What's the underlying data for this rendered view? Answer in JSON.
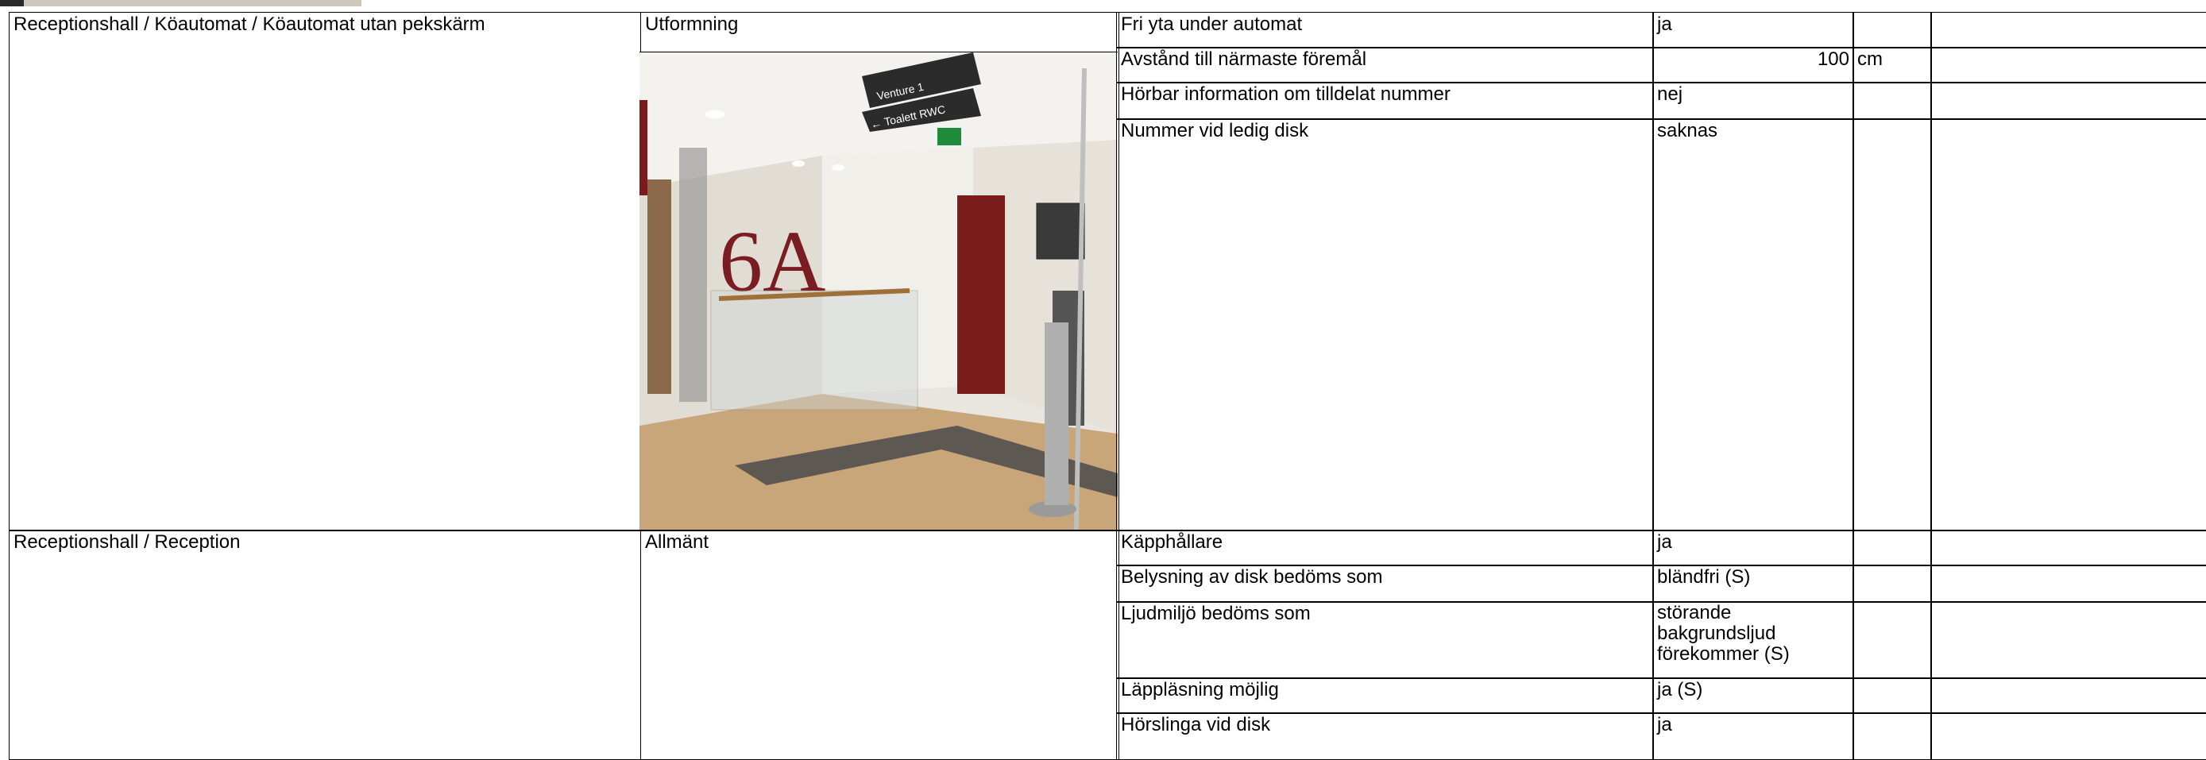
{
  "sections": [
    {
      "location": "Receptionshall / Köautomat / Köautomat utan pekskärm",
      "category": "Utformning",
      "rows": [
        {
          "label": "Fri yta under automat",
          "value": "ja",
          "unit": ""
        },
        {
          "label": "Avstånd till närmaste föremål",
          "value": "100",
          "unit": "cm"
        },
        {
          "label": "Hörbar information om tilldelat nummer",
          "value": "nej",
          "unit": ""
        },
        {
          "label": "Nummer vid ledig disk",
          "value": "saknas",
          "unit": ""
        }
      ]
    },
    {
      "location": "Receptionshall / Reception",
      "category": "Allmänt",
      "rows": [
        {
          "label": "Käpphållare",
          "value": "ja",
          "unit": ""
        },
        {
          "label": "Belysning av disk bedöms som",
          "value": "bländfri (S)",
          "unit": ""
        },
        {
          "label": "Ljudmiljö bedöms som",
          "value": "störande bakgrundsljud förekommer (S)",
          "unit": ""
        },
        {
          "label": "Läppläsning möjlig",
          "value": "ja (S)",
          "unit": ""
        },
        {
          "label": "Hörslinga vid disk",
          "value": "ja",
          "unit": ""
        }
      ]
    }
  ],
  "photo": {
    "sign_text_1": "Venture 1",
    "sign_text_2": "← Toalett RWC",
    "wall_logo": "6A"
  }
}
